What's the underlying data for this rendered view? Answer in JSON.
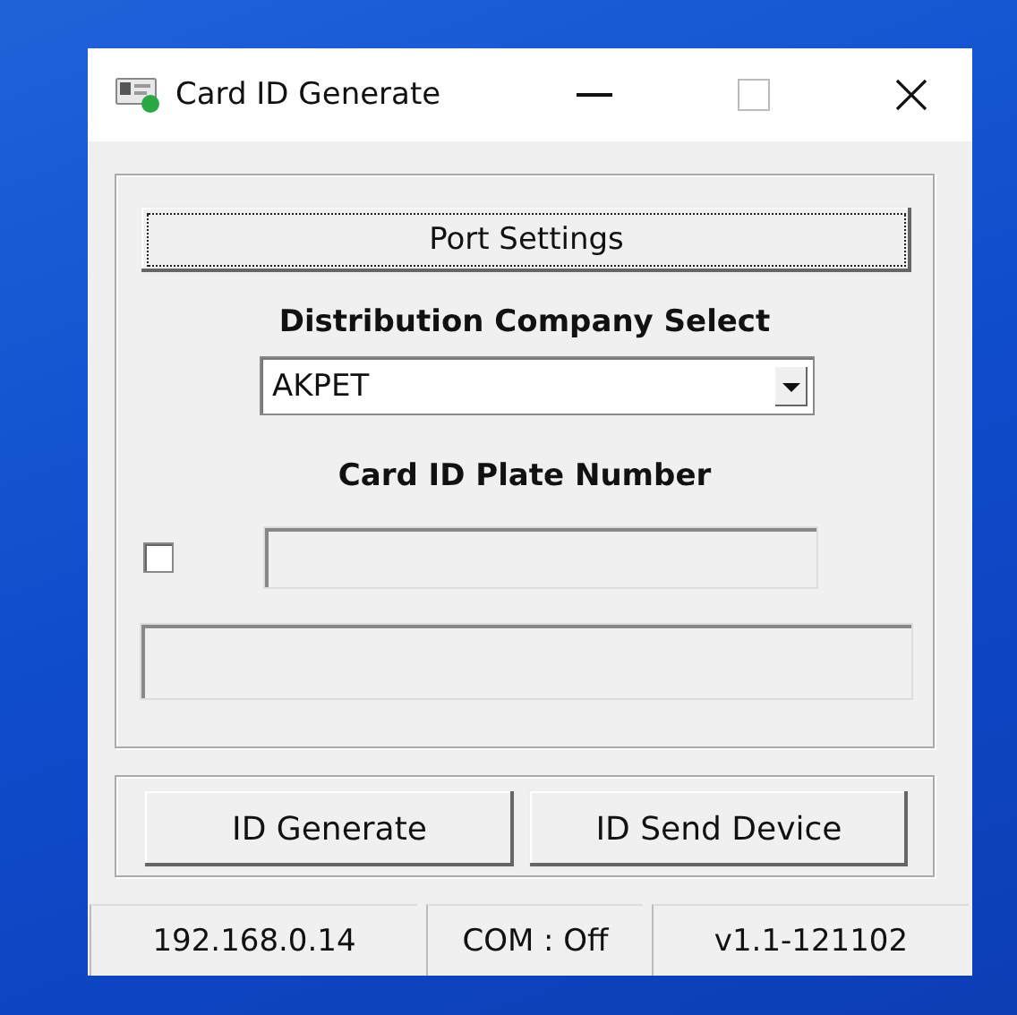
{
  "window": {
    "title": "Card ID Generate"
  },
  "port_settings_button": "Port Settings",
  "company_label": "Distribution Company Select",
  "company_select": {
    "value": "AKPET"
  },
  "plate_label": "Card ID Plate Number",
  "plate_checkbox": {
    "checked": false
  },
  "buttons": [
    "ID Generate",
    "ID Send Device"
  ],
  "status_bar": [
    "192.168.0.14",
    "COM : Off",
    "v1.1-121102"
  ]
}
